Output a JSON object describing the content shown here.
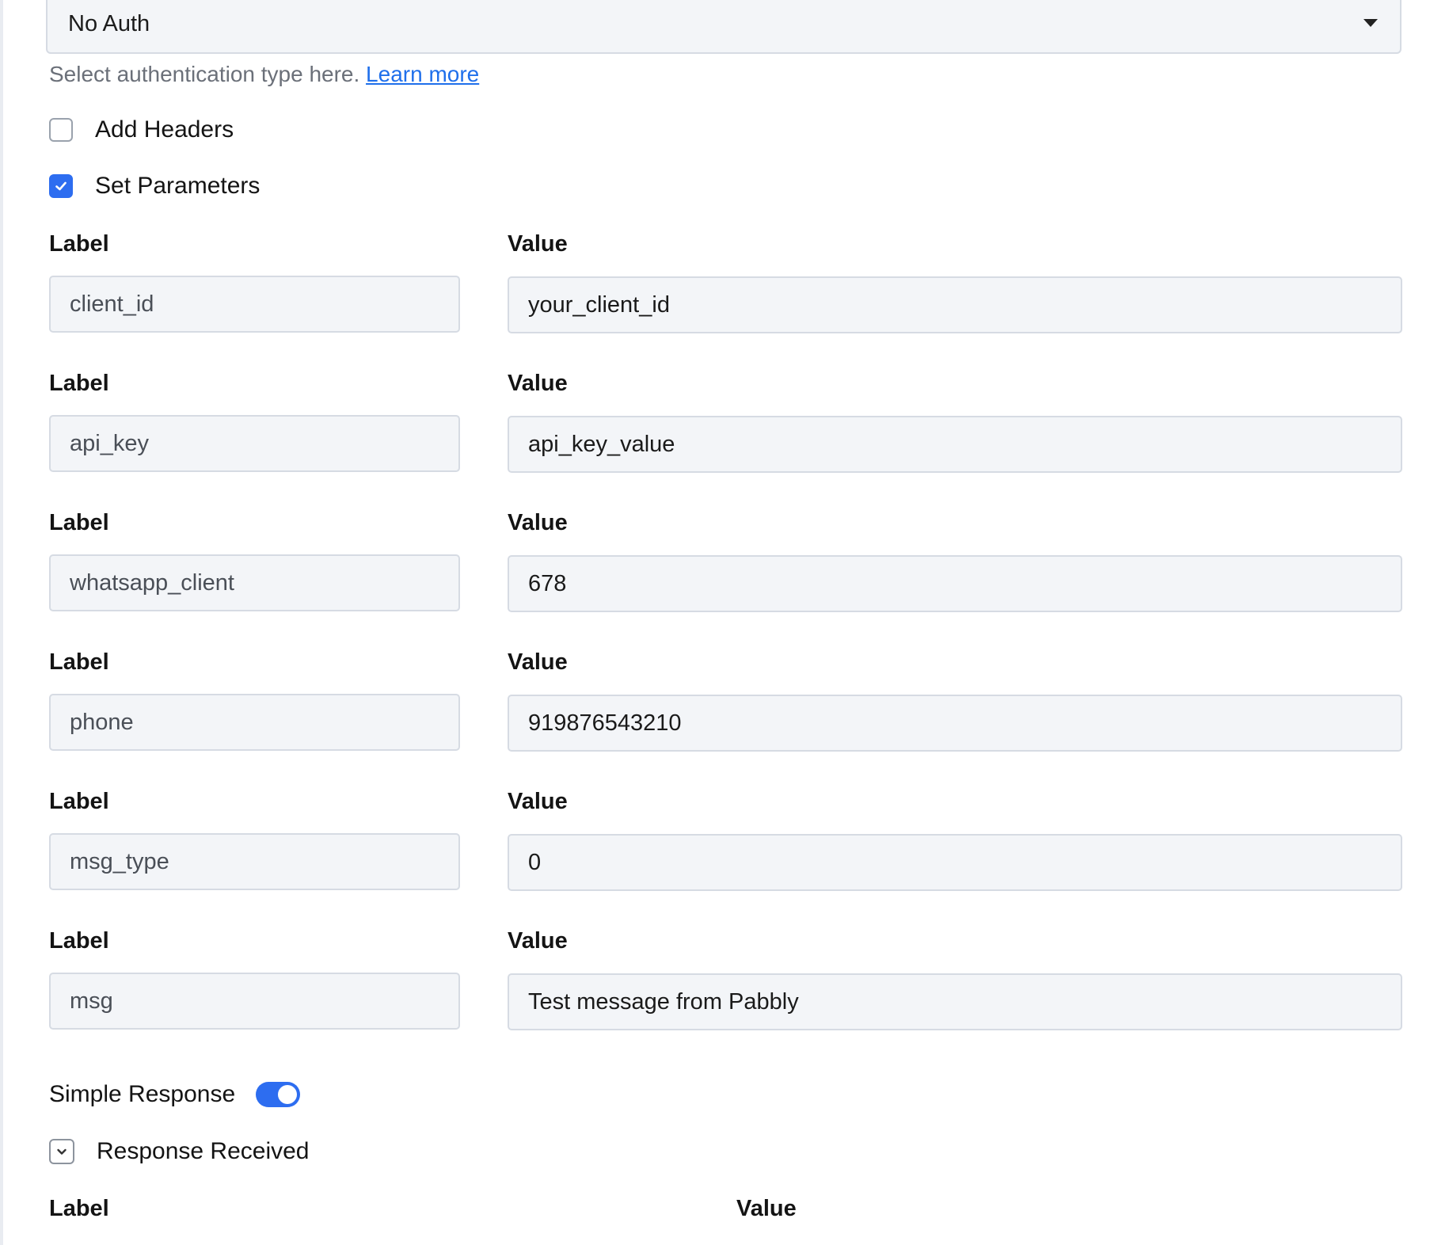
{
  "auth": {
    "selected": "No Auth",
    "help_text": "Select authentication type here.",
    "learn_more": "Learn more"
  },
  "options": {
    "add_headers": {
      "label": "Add Headers",
      "checked": false
    },
    "set_parameters": {
      "label": "Set Parameters",
      "checked": true
    }
  },
  "params": {
    "label_header": "Label",
    "value_header": "Value",
    "rows": [
      {
        "label": "client_id",
        "value": "your_client_id"
      },
      {
        "label": "api_key",
        "value": "api_key_value"
      },
      {
        "label": "whatsapp_client",
        "value": "678"
      },
      {
        "label": "phone",
        "value": "919876543210"
      },
      {
        "label": "msg_type",
        "value": "0"
      },
      {
        "label": "msg",
        "value": "Test message from Pabbly"
      }
    ]
  },
  "simple_response": {
    "label": "Simple Response",
    "enabled": true
  },
  "response_received": {
    "label": "Response Received"
  },
  "response_table": {
    "label_header": "Label",
    "value_header": "Value"
  },
  "colors": {
    "accent": "#2d6df0",
    "link": "#1f6feb",
    "field_bg": "#f3f5f8"
  }
}
